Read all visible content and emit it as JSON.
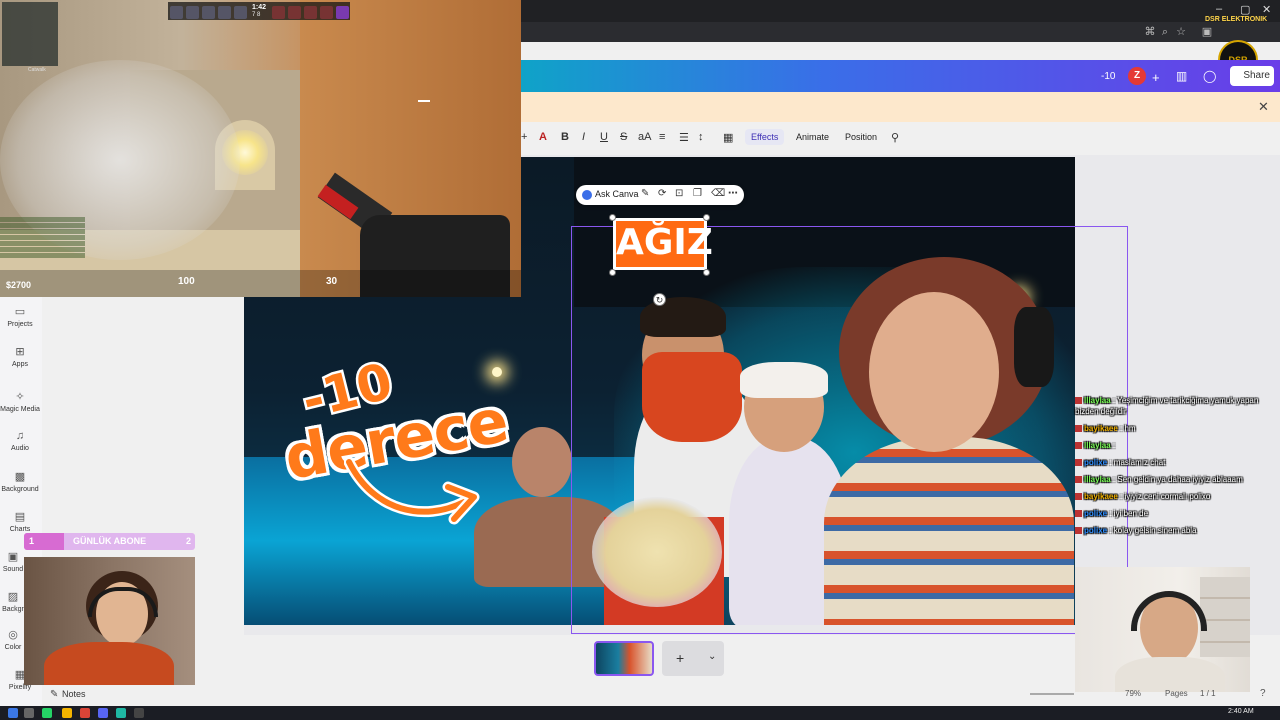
{
  "colors": {
    "canva_gradient_start": "#0fa3c8",
    "canva_gradient_end": "#6a3de8",
    "selection": "#8a57f0",
    "banner": "#fde8cc",
    "accent_orange": "#ff6a12",
    "abone_bar": "#e0b6ee"
  },
  "browser": {
    "channel_badge": "DSR ELEKTRONIK",
    "logo_text": "DSR",
    "window_controls": [
      "–",
      "▢",
      "✕"
    ]
  },
  "header": {
    "count": "-10",
    "avatar_initial": "Z",
    "add_icon": "+",
    "share_label": "Share"
  },
  "toolbar": {
    "effects": "Effects",
    "animate": "Animate",
    "position": "Position"
  },
  "ask_canva": {
    "label": "Ask Canva"
  },
  "design": {
    "text_minus": "-10",
    "text_derece": "derece",
    "text_agiz": "AĞIZ"
  },
  "sidebar": {
    "items": [
      {
        "label": "Projects",
        "icon": "folder-icon"
      },
      {
        "label": "Apps",
        "icon": "apps-icon"
      },
      {
        "label": "Magic Media",
        "icon": "magic-media-icon"
      },
      {
        "label": "Audio",
        "icon": "music-note-icon"
      },
      {
        "label": "Background",
        "icon": "background-icon"
      },
      {
        "label": "Charts",
        "icon": "chart-icon"
      },
      {
        "label": "Sound",
        "icon": "sound-icon"
      },
      {
        "label": "Backgr",
        "icon": "background-icon"
      },
      {
        "label": "Color",
        "icon": "color-icon"
      },
      {
        "label": "Pixelify",
        "icon": "pixelify-icon"
      }
    ],
    "notes": "Notes"
  },
  "game": {
    "minimap_label": "Catwalk",
    "round_time": "1:42",
    "round_score": "7   8",
    "money": "$2700",
    "health": "100",
    "ammo": "30"
  },
  "abone": {
    "left_num": "1",
    "label": "GÜNLÜK ABONE",
    "right_num": "2"
  },
  "chat": [
    {
      "user": "lllaylaa",
      "color": "#7cff5a",
      "text": " : Yeşimciğim ve tarikciğima yamuk yapan bizden değildir"
    },
    {
      "user": "bayikaee",
      "color": "#f0b000",
      "text": " : hm"
    },
    {
      "user": "lllaylaa",
      "color": "#7cff5a",
      "text": " : "
    },
    {
      "user": "polixe",
      "color": "#2b8cff",
      "text": " : maslamız chat"
    },
    {
      "user": "lllaylaa",
      "color": "#7cff5a",
      "text": " : Sen geldin ya dahaa iyiyiz ablaaam"
    },
    {
      "user": "bayikaee",
      "color": "#f0b000",
      "text": " : iyiyiz ceni cormalı polixo"
    },
    {
      "user": "polixe",
      "color": "#2b8cff",
      "text": " : iyi ben de"
    },
    {
      "user": "polixe",
      "color": "#2b8cff",
      "text": " : kolay gelsin sinem abla"
    }
  ],
  "footer": {
    "zoom": "79%",
    "pages_label": "Pages",
    "page_count": "1 / 1",
    "help": "?"
  },
  "taskbar": {
    "time": "2:40 AM"
  }
}
